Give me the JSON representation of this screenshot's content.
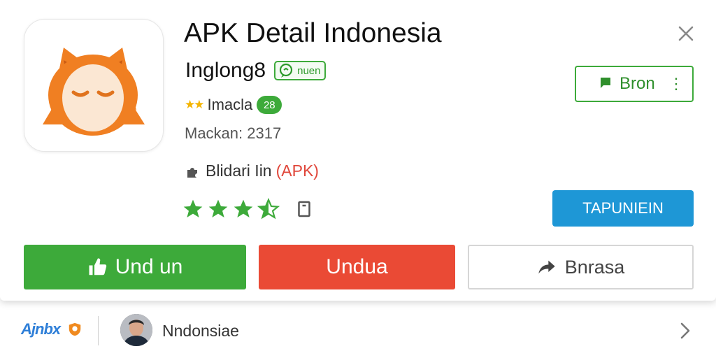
{
  "app": {
    "title": "APK Detail Indonesia",
    "subtitle": "Inglong8",
    "tag_label": "nuen",
    "rating_label": "Imacla",
    "rating_badge": "28",
    "meta": "Mackan: 2317",
    "source_text": "Blidari Iin",
    "source_apk": "(APK)",
    "star_rating": 3.5,
    "icon_name": "fox-face-icon"
  },
  "actions": {
    "save_label": "Bron",
    "install_label": "TAPUNIEIN",
    "primary_label": "Und un",
    "secondary_label": "Undua",
    "share_label": "Bnrasa"
  },
  "footer": {
    "brand": "Ajnbx",
    "name": "Nndonsiae"
  },
  "colors": {
    "green": "#3daa3a",
    "red": "#ea4a35",
    "blue": "#1e97d6",
    "orange": "#f07f22",
    "star_yellow": "#f4b400"
  }
}
